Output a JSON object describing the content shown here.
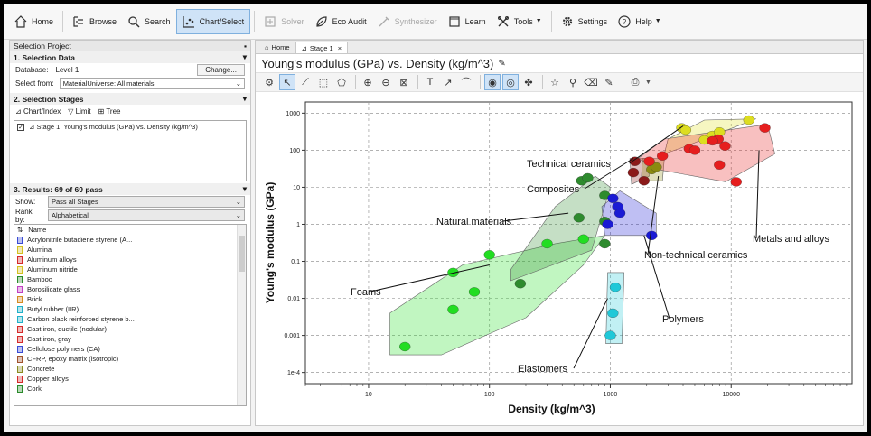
{
  "toolbar": {
    "home": "Home",
    "browse": "Browse",
    "search": "Search",
    "chart_select": "Chart/Select",
    "solver": "Solver",
    "eco_audit": "Eco Audit",
    "synthesizer": "Synthesizer",
    "learn": "Learn",
    "tools": "Tools",
    "settings": "Settings",
    "help": "Help"
  },
  "left": {
    "panel_title": "Selection Project",
    "sec1": "1. Selection Data",
    "database_label": "Database:",
    "database_value": "Level 1",
    "change_button": "Change...",
    "select_from_label": "Select from:",
    "select_from_value": "MaterialUniverse: All materials",
    "sec2": "2. Selection Stages",
    "stage_tools": [
      "Chart/Index",
      "Limit",
      "Tree"
    ],
    "stage_entry": "Stage 1: Young's modulus (GPa) vs. Density (kg/m^3)",
    "sec3": "3. Results: 69 of 69 pass",
    "show_label": "Show:",
    "show_value": "Pass all Stages",
    "rank_label": "Rank by:",
    "rank_value": "Alphabetical",
    "list_header": "Name",
    "materials": [
      {
        "name": "Acrylonitrile butadiene styrene (A...",
        "color": "#3a4bd4"
      },
      {
        "name": "Alumina",
        "color": "#d4c020"
      },
      {
        "name": "Aluminum alloys",
        "color": "#d42a2a"
      },
      {
        "name": "Aluminum nitride",
        "color": "#d4c020"
      },
      {
        "name": "Bamboo",
        "color": "#2a8a2a"
      },
      {
        "name": "Borosilicate glass",
        "color": "#c040c0"
      },
      {
        "name": "Brick",
        "color": "#d48a20"
      },
      {
        "name": "Butyl rubber (IIR)",
        "color": "#20b0c8"
      },
      {
        "name": "Carbon black reinforced styrene b...",
        "color": "#20b0c8"
      },
      {
        "name": "Cast iron, ductile (nodular)",
        "color": "#d42a2a"
      },
      {
        "name": "Cast iron, gray",
        "color": "#d42a2a"
      },
      {
        "name": "Cellulose polymers (CA)",
        "color": "#3a4bd4"
      },
      {
        "name": "CFRP, epoxy matrix (isotropic)",
        "color": "#a0522d"
      },
      {
        "name": "Concrete",
        "color": "#8a8a20"
      },
      {
        "name": "Copper alloys",
        "color": "#d42a2a"
      },
      {
        "name": "Cork",
        "color": "#2a8a2a"
      }
    ]
  },
  "right": {
    "tab_home": "Home",
    "tab_stage": "Stage 1",
    "chart_title": "Young's modulus (GPa) vs. Density (kg/m^3)"
  },
  "chart_data": {
    "type": "scatter",
    "title": "Young's modulus (GPa) vs. Density (kg/m^3)",
    "xlabel": "Density (kg/m^3)",
    "ylabel": "Young's modulus (GPa)",
    "x_scale": "log",
    "y_scale": "log",
    "xlim": [
      3,
      100000
    ],
    "ylim": [
      5e-05,
      2000
    ],
    "x_ticks": [
      10,
      100,
      1000,
      10000
    ],
    "x_tick_labels": [
      "10",
      "100",
      "1000",
      "10000"
    ],
    "y_ticks": [
      0.0001,
      0.001,
      0.01,
      0.1,
      1,
      10,
      100,
      1000
    ],
    "y_tick_labels": [
      "1e-4",
      "0.001",
      "0.01",
      "0.1",
      "1",
      "10",
      "100",
      "1000"
    ],
    "grid": true,
    "families": [
      {
        "name": "Foams",
        "color": "#22dd22",
        "envelope": [
          [
            15,
            0.0003
          ],
          [
            40,
            0.0003
          ],
          [
            200,
            0.003
          ],
          [
            600,
            0.08
          ],
          [
            900,
            0.5
          ],
          [
            350,
            0.3
          ],
          [
            60,
            0.08
          ],
          [
            15,
            0.004
          ]
        ],
        "points": [
          [
            20,
            0.0005
          ],
          [
            50,
            0.005
          ],
          [
            75,
            0.015
          ],
          [
            50,
            0.05
          ],
          [
            100,
            0.15
          ],
          [
            300,
            0.3
          ],
          [
            600,
            0.4
          ]
        ]
      },
      {
        "name": "Natural materials",
        "color": "#2e8b2e",
        "envelope": [
          [
            150,
            0.03
          ],
          [
            700,
            0.2
          ],
          [
            1000,
            10
          ],
          [
            750,
            20
          ],
          [
            350,
            3
          ],
          [
            150,
            0.06
          ]
        ],
        "points": [
          [
            180,
            0.025
          ],
          [
            550,
            1.5
          ],
          [
            580,
            15
          ],
          [
            650,
            18
          ],
          [
            900,
            6
          ],
          [
            900,
            1.2
          ],
          [
            900,
            0.3
          ]
        ]
      },
      {
        "name": "Polymers",
        "color": "#1a1ad4",
        "envelope": [
          [
            900,
            0.5
          ],
          [
            2400,
            0.5
          ],
          [
            2400,
            2
          ],
          [
            1200,
            8
          ],
          [
            850,
            3
          ]
        ],
        "points": [
          [
            1050,
            5
          ],
          [
            1150,
            3
          ],
          [
            1200,
            2
          ],
          [
            2200,
            0.5
          ],
          [
            950,
            1
          ]
        ]
      },
      {
        "name": "Elastomers",
        "color": "#20c8d8",
        "envelope": [
          [
            920,
            0.0006
          ],
          [
            1250,
            0.0006
          ],
          [
            1300,
            0.05
          ],
          [
            950,
            0.05
          ]
        ],
        "points": [
          [
            1100,
            0.02
          ],
          [
            1050,
            0.004
          ],
          [
            1000,
            0.001
          ]
        ]
      },
      {
        "name": "Composites",
        "color": "#8b1a1a",
        "envelope": [
          [
            1450,
            60
          ],
          [
            2000,
            60
          ],
          [
            2100,
            20
          ],
          [
            1500,
            12
          ]
        ],
        "points": [
          [
            1600,
            50
          ],
          [
            1550,
            25
          ],
          [
            1900,
            15
          ]
        ]
      },
      {
        "name": "Non-technical ceramics",
        "color": "#8b8b10",
        "envelope": [
          [
            1800,
            15
          ],
          [
            2700,
            15
          ],
          [
            2800,
            60
          ],
          [
            1850,
            60
          ]
        ],
        "points": [
          [
            2200,
            30
          ],
          [
            2400,
            35
          ]
        ]
      },
      {
        "name": "Technical ceramics",
        "color": "#dddd20",
        "envelope": [
          [
            2800,
            80
          ],
          [
            4000,
            120
          ],
          [
            16000,
            700
          ],
          [
            6000,
            650
          ],
          [
            3000,
            200
          ]
        ],
        "points": [
          [
            3900,
            400
          ],
          [
            4200,
            350
          ],
          [
            7000,
            250
          ],
          [
            6000,
            190
          ],
          [
            8000,
            310
          ],
          [
            14000,
            650
          ]
        ]
      },
      {
        "name": "Metals and alloys",
        "color": "#e61e1e",
        "envelope": [
          [
            1700,
            60
          ],
          [
            2500,
            30
          ],
          [
            9000,
            14
          ],
          [
            23000,
            80
          ],
          [
            20000,
            500
          ],
          [
            2800,
            200
          ]
        ],
        "points": [
          [
            2700,
            70
          ],
          [
            4500,
            110
          ],
          [
            7800,
            200
          ],
          [
            8900,
            130
          ],
          [
            8000,
            40
          ],
          [
            19000,
            400
          ],
          [
            11000,
            14
          ],
          [
            5000,
            100
          ],
          [
            7000,
            180
          ],
          [
            2100,
            50
          ]
        ]
      }
    ],
    "annotations": [
      {
        "text": "Technical ceramics",
        "target": [
          4000,
          450
        ]
      },
      {
        "text": "Composites",
        "target": [
          1550,
          60
        ]
      },
      {
        "text": "Natural materials",
        "target": [
          450,
          2
        ]
      },
      {
        "text": "Metals and alloys",
        "target": [
          17000,
          100
        ]
      },
      {
        "text": "Non-technical ceramics",
        "target": [
          2500,
          20
        ]
      },
      {
        "text": "Foams",
        "target": [
          100,
          0.08
        ]
      },
      {
        "text": "Polymers",
        "target": [
          1900,
          0.5
        ]
      },
      {
        "text": "Elastomers",
        "target": [
          950,
          0.01
        ]
      }
    ]
  }
}
